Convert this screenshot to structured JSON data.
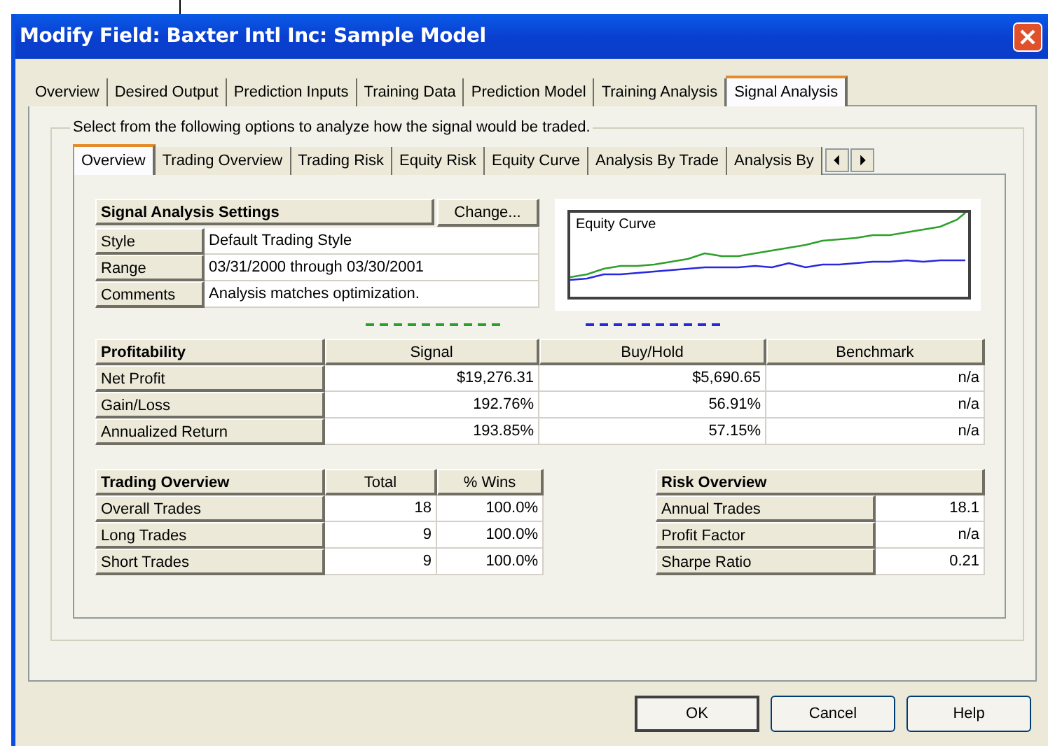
{
  "window": {
    "title": "Modify Field: Baxter Intl Inc: Sample Model"
  },
  "tabs": [
    {
      "label": "Overview",
      "selected": false
    },
    {
      "label": "Desired Output",
      "selected": false
    },
    {
      "label": "Prediction Inputs",
      "selected": false
    },
    {
      "label": "Training Data",
      "selected": false
    },
    {
      "label": "Prediction Model",
      "selected": false
    },
    {
      "label": "Training Analysis",
      "selected": false
    },
    {
      "label": "Signal Analysis",
      "selected": true
    }
  ],
  "group_label": "Select from the following options to analyze how the signal would be traded.",
  "subtabs": [
    {
      "label": "Overview",
      "selected": true
    },
    {
      "label": "Trading Overview",
      "selected": false
    },
    {
      "label": "Trading Risk",
      "selected": false
    },
    {
      "label": "Equity Risk",
      "selected": false
    },
    {
      "label": "Equity Curve",
      "selected": false
    },
    {
      "label": "Analysis By Trade",
      "selected": false
    },
    {
      "label": "Analysis By",
      "selected": false
    }
  ],
  "settings": {
    "title": "Signal Analysis Settings",
    "change_button": "Change...",
    "rows": [
      {
        "label": "Style",
        "value": "Default Trading Style"
      },
      {
        "label": "Range",
        "value": "03/31/2000 through 03/30/2001"
      },
      {
        "label": "Comments",
        "value": "Analysis matches optimization."
      }
    ]
  },
  "equity_chart": {
    "title": "Equity Curve"
  },
  "profitability": {
    "columns": [
      {
        "label": "Profitability"
      },
      {
        "label": "Signal",
        "color": "#2ca02c"
      },
      {
        "label": "Buy/Hold",
        "color": "#2828e0"
      },
      {
        "label": "Benchmark"
      }
    ],
    "rows": [
      {
        "label": "Net Profit",
        "values": [
          "$19,276.31",
          "$5,690.65",
          "n/a"
        ]
      },
      {
        "label": "Gain/Loss",
        "values": [
          "192.76%",
          "56.91%",
          "n/a"
        ]
      },
      {
        "label": "Annualized Return",
        "values": [
          "193.85%",
          "57.15%",
          "n/a"
        ]
      }
    ]
  },
  "trading_overview": {
    "columns": [
      "Trading Overview",
      "Total",
      "% Wins"
    ],
    "rows": [
      {
        "label": "Overall Trades",
        "values": [
          "18",
          "100.0%"
        ]
      },
      {
        "label": "Long Trades",
        "values": [
          "9",
          "100.0%"
        ]
      },
      {
        "label": "Short Trades",
        "values": [
          "9",
          "100.0%"
        ]
      }
    ]
  },
  "risk_overview": {
    "title": "Risk Overview",
    "rows": [
      {
        "label": "Annual Trades",
        "value": "18.1"
      },
      {
        "label": "Profit Factor",
        "value": "n/a"
      },
      {
        "label": "Sharpe Ratio",
        "value": "0.21"
      }
    ]
  },
  "buttons": [
    {
      "label": "OK",
      "default": true
    },
    {
      "label": "Cancel",
      "default": false
    },
    {
      "label": "Help",
      "default": false
    }
  ]
}
